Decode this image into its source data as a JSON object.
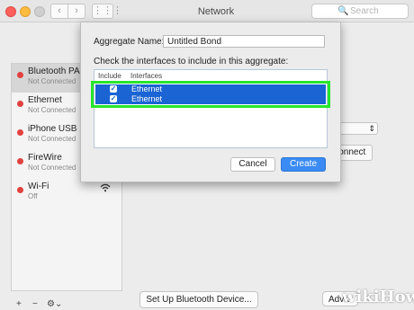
{
  "window": {
    "title": "Network",
    "nav_back": "‹",
    "nav_forward": "›",
    "grid_icon": "⋮⋮⋮"
  },
  "search": {
    "icon": "🔍",
    "placeholder": "Search"
  },
  "sidebar": {
    "items": [
      {
        "name": "Bluetooth PAN",
        "status": "Not Connected",
        "dot": "#e0413e",
        "selected": true
      },
      {
        "name": "Ethernet",
        "status": "Not Connected",
        "dot": "#e0413e"
      },
      {
        "name": "iPhone USB",
        "status": "Not Connected",
        "dot": "#e0413e"
      },
      {
        "name": "FireWire",
        "status": "Not Connected",
        "dot": "#e0413e"
      },
      {
        "name": "Wi-Fi",
        "status": "Off",
        "dot": "#e0413e",
        "icon": "wifi-icon"
      }
    ],
    "footer": {
      "add": "+",
      "remove": "−",
      "gear": "⚙︎⌄"
    }
  },
  "main": {
    "dropdown_arrow": "⇕",
    "connect_label": "Connect",
    "setup_label": "Set Up Bluetooth Device...",
    "advanced_label": "Adva"
  },
  "sheet": {
    "aggregate_label": "Aggregate Name:",
    "aggregate_value": "Untitled Bond",
    "instruction": "Check the interfaces to include in this aggregate:",
    "headers": {
      "include": "Include",
      "interfaces": "Interfaces"
    },
    "rows": [
      {
        "checked": "✓",
        "name": "Ethernet"
      },
      {
        "checked": "✓",
        "name": "Ethernet"
      }
    ],
    "cancel_label": "Cancel",
    "create_label": "Create"
  },
  "watermark": "wikiHow",
  "colors": {
    "selection": "#1a64d4",
    "highlight_box": "#27e52c",
    "primary_button": "#3a8bf3",
    "status_dot": "#e0413e"
  }
}
